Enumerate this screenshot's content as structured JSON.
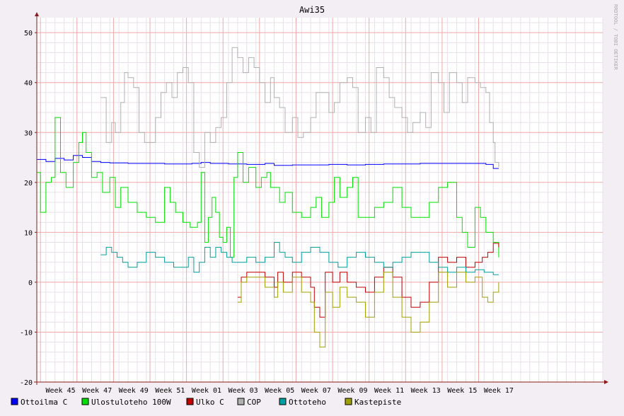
{
  "chart_data": {
    "type": "line",
    "title": "Awi35",
    "watermark": "RRDTOOL / TOBI OETIKER",
    "xlabel": "",
    "ylabel": "",
    "ylim": [
      -20,
      53
    ],
    "yticks": [
      -20,
      -10,
      0,
      10,
      20,
      30,
      40,
      50
    ],
    "xlim": [
      0,
      31
    ],
    "xticks": [
      {
        "x": 1.3,
        "label": "Week 45"
      },
      {
        "x": 3.3,
        "label": "Week 47"
      },
      {
        "x": 5.3,
        "label": "Week 49"
      },
      {
        "x": 7.3,
        "label": "Week 51"
      },
      {
        "x": 9.3,
        "label": "Week 01"
      },
      {
        "x": 11.3,
        "label": "Week 03"
      },
      {
        "x": 13.3,
        "label": "Week 05"
      },
      {
        "x": 15.3,
        "label": "Week 07"
      },
      {
        "x": 17.3,
        "label": "Week 09"
      },
      {
        "x": 19.3,
        "label": "Week 11"
      },
      {
        "x": 21.3,
        "label": "Week 13"
      },
      {
        "x": 23.3,
        "label": "Week 15"
      },
      {
        "x": 25.3,
        "label": "Week 17"
      }
    ],
    "grid": true,
    "legend_position": "bottom",
    "colors": {
      "background": "#f3eef3",
      "canvas": "#ffffff",
      "major_grid": "#f0a8a8",
      "minor_grid": "#e8e0e8",
      "axis": "#8b1a1a"
    },
    "series": [
      {
        "name": "Ottoilma C",
        "color": "#0000ff",
        "points": [
          [
            0,
            24.6
          ],
          [
            0.5,
            24.2
          ],
          [
            1.0,
            24.8
          ],
          [
            1.5,
            24.5
          ],
          [
            2.0,
            25.4
          ],
          [
            2.5,
            25.0
          ],
          [
            3.0,
            24.2
          ],
          [
            3.5,
            24.0
          ],
          [
            4.0,
            23.9
          ],
          [
            5.0,
            23.8
          ],
          [
            6.0,
            23.8
          ],
          [
            7.0,
            23.7
          ],
          [
            7.6,
            23.7
          ],
          [
            8.5,
            23.8
          ],
          [
            9.0,
            24.0
          ],
          [
            9.5,
            23.8
          ],
          [
            10.5,
            23.7
          ],
          [
            11.5,
            23.6
          ],
          [
            12.5,
            23.8
          ],
          [
            13.0,
            23.4
          ],
          [
            14.0,
            23.5
          ],
          [
            15.0,
            23.5
          ],
          [
            16.0,
            23.6
          ],
          [
            17.0,
            23.5
          ],
          [
            18.0,
            23.6
          ],
          [
            19.0,
            23.7
          ],
          [
            20.0,
            23.7
          ],
          [
            21.0,
            23.8
          ],
          [
            22.0,
            23.8
          ],
          [
            23.0,
            23.8
          ],
          [
            24.0,
            23.8
          ],
          [
            24.6,
            23.6
          ],
          [
            25.0,
            22.8
          ],
          [
            25.3,
            22.8
          ]
        ]
      },
      {
        "name": "Ulostuloteho 100W",
        "color": "#00e000",
        "points": [
          [
            0,
            22
          ],
          [
            0.2,
            14
          ],
          [
            0.5,
            20
          ],
          [
            0.8,
            21
          ],
          [
            1.0,
            33
          ],
          [
            1.3,
            22
          ],
          [
            1.6,
            19
          ],
          [
            2.0,
            24
          ],
          [
            2.3,
            28
          ],
          [
            2.5,
            30
          ],
          [
            2.7,
            26
          ],
          [
            3.0,
            21
          ],
          [
            3.3,
            22
          ],
          [
            3.6,
            18
          ],
          [
            4.0,
            21
          ],
          [
            4.3,
            15
          ],
          [
            4.6,
            19
          ],
          [
            5.0,
            16
          ],
          [
            5.5,
            14
          ],
          [
            6.0,
            13
          ],
          [
            6.5,
            12
          ],
          [
            7.0,
            19
          ],
          [
            7.3,
            16
          ],
          [
            7.6,
            14
          ],
          [
            8.0,
            12
          ],
          [
            8.4,
            11
          ],
          [
            8.8,
            12
          ],
          [
            9.0,
            22
          ],
          [
            9.2,
            8
          ],
          [
            9.4,
            13
          ],
          [
            9.6,
            17
          ],
          [
            9.8,
            14
          ],
          [
            10.0,
            9
          ],
          [
            10.2,
            8
          ],
          [
            10.4,
            11
          ],
          [
            10.6,
            5
          ],
          [
            10.8,
            21
          ],
          [
            11.0,
            26
          ],
          [
            11.3,
            20
          ],
          [
            11.6,
            23
          ],
          [
            12.0,
            19
          ],
          [
            12.3,
            21
          ],
          [
            12.6,
            22
          ],
          [
            12.8,
            19
          ],
          [
            13.0,
            19
          ],
          [
            13.3,
            16
          ],
          [
            13.6,
            18
          ],
          [
            14.0,
            14
          ],
          [
            14.5,
            13
          ],
          [
            15.0,
            15
          ],
          [
            15.3,
            17
          ],
          [
            15.6,
            13
          ],
          [
            16.0,
            16
          ],
          [
            16.3,
            21
          ],
          [
            16.6,
            17
          ],
          [
            17.0,
            19
          ],
          [
            17.3,
            21
          ],
          [
            17.6,
            13
          ],
          [
            18.0,
            13
          ],
          [
            18.5,
            15
          ],
          [
            19.0,
            16
          ],
          [
            19.5,
            19
          ],
          [
            20.0,
            15
          ],
          [
            20.5,
            13
          ],
          [
            21.0,
            13
          ],
          [
            21.5,
            16
          ],
          [
            22.0,
            19
          ],
          [
            22.5,
            20
          ],
          [
            23.0,
            13
          ],
          [
            23.3,
            10
          ],
          [
            23.6,
            7
          ],
          [
            24.0,
            15
          ],
          [
            24.3,
            13
          ],
          [
            24.6,
            10
          ],
          [
            25.0,
            8
          ],
          [
            25.3,
            5
          ]
        ]
      },
      {
        "name": "Ulko C",
        "color": "#c00000",
        "points": [
          [
            11.0,
            -3
          ],
          [
            11.2,
            1
          ],
          [
            11.5,
            2
          ],
          [
            12.0,
            2
          ],
          [
            12.5,
            1
          ],
          [
            13.0,
            -1
          ],
          [
            13.2,
            2
          ],
          [
            13.5,
            0
          ],
          [
            14.0,
            2
          ],
          [
            14.5,
            1
          ],
          [
            15.0,
            -1
          ],
          [
            15.2,
            -5
          ],
          [
            15.5,
            -7
          ],
          [
            15.8,
            2
          ],
          [
            16.2,
            0
          ],
          [
            16.6,
            2
          ],
          [
            17.0,
            0
          ],
          [
            17.5,
            -1
          ],
          [
            18.0,
            -2
          ],
          [
            18.5,
            1
          ],
          [
            19.0,
            3
          ],
          [
            19.5,
            1
          ],
          [
            20.0,
            -3
          ],
          [
            20.5,
            -5
          ],
          [
            21.0,
            -4
          ],
          [
            21.5,
            0
          ],
          [
            22.0,
            5
          ],
          [
            22.5,
            4
          ],
          [
            23.0,
            5
          ],
          [
            23.5,
            3
          ],
          [
            24.0,
            4
          ],
          [
            24.4,
            5
          ],
          [
            24.7,
            6
          ],
          [
            25.0,
            7.8
          ],
          [
            25.3,
            7
          ]
        ]
      },
      {
        "name": "COP",
        "color": "#b0b0b0",
        "points": [
          [
            3.5,
            37
          ],
          [
            3.8,
            28
          ],
          [
            4.1,
            32
          ],
          [
            4.3,
            30
          ],
          [
            4.6,
            36
          ],
          [
            4.8,
            42
          ],
          [
            5.0,
            41
          ],
          [
            5.3,
            39
          ],
          [
            5.6,
            30
          ],
          [
            5.9,
            28
          ],
          [
            6.2,
            28
          ],
          [
            6.5,
            33
          ],
          [
            6.8,
            38
          ],
          [
            7.1,
            40
          ],
          [
            7.4,
            37
          ],
          [
            7.7,
            42
          ],
          [
            8.0,
            43
          ],
          [
            8.3,
            40
          ],
          [
            8.6,
            26
          ],
          [
            8.9,
            23
          ],
          [
            9.2,
            30
          ],
          [
            9.5,
            28
          ],
          [
            9.8,
            31
          ],
          [
            10.1,
            33
          ],
          [
            10.4,
            40
          ],
          [
            10.7,
            47
          ],
          [
            11.0,
            45
          ],
          [
            11.3,
            42
          ],
          [
            11.6,
            45
          ],
          [
            11.9,
            43
          ],
          [
            12.2,
            40
          ],
          [
            12.5,
            36
          ],
          [
            12.8,
            41
          ],
          [
            13.0,
            37
          ],
          [
            13.3,
            35
          ],
          [
            13.6,
            30
          ],
          [
            14.0,
            33
          ],
          [
            14.3,
            29
          ],
          [
            14.6,
            30
          ],
          [
            15.0,
            33
          ],
          [
            15.3,
            38
          ],
          [
            15.6,
            38
          ],
          [
            16.0,
            34
          ],
          [
            16.3,
            36
          ],
          [
            16.6,
            40
          ],
          [
            17.0,
            41
          ],
          [
            17.3,
            39
          ],
          [
            17.6,
            30
          ],
          [
            18.0,
            33
          ],
          [
            18.3,
            30
          ],
          [
            18.6,
            43
          ],
          [
            19.0,
            41
          ],
          [
            19.3,
            37
          ],
          [
            19.6,
            35
          ],
          [
            20.0,
            33
          ],
          [
            20.3,
            30
          ],
          [
            20.6,
            32
          ],
          [
            21.0,
            34
          ],
          [
            21.3,
            31
          ],
          [
            21.6,
            42
          ],
          [
            22.0,
            40
          ],
          [
            22.3,
            34
          ],
          [
            22.6,
            42
          ],
          [
            23.0,
            40
          ],
          [
            23.3,
            36
          ],
          [
            23.6,
            41
          ],
          [
            24.0,
            40
          ],
          [
            24.3,
            39
          ],
          [
            24.6,
            38
          ],
          [
            24.8,
            32
          ],
          [
            25.0,
            28
          ],
          [
            25.1,
            24
          ],
          [
            25.3,
            23
          ]
        ]
      },
      {
        "name": "Ottoteho",
        "color": "#00a0a0",
        "points": [
          [
            3.5,
            5.5
          ],
          [
            3.8,
            7
          ],
          [
            4.1,
            6
          ],
          [
            4.4,
            5
          ],
          [
            4.7,
            4
          ],
          [
            5.0,
            3
          ],
          [
            5.5,
            4
          ],
          [
            6.0,
            6
          ],
          [
            6.5,
            5
          ],
          [
            7.0,
            4
          ],
          [
            7.5,
            3
          ],
          [
            8.0,
            3
          ],
          [
            8.3,
            5
          ],
          [
            8.6,
            2
          ],
          [
            8.9,
            4
          ],
          [
            9.2,
            7
          ],
          [
            9.5,
            5
          ],
          [
            9.8,
            7
          ],
          [
            10.1,
            6
          ],
          [
            10.4,
            5
          ],
          [
            10.7,
            4
          ],
          [
            11.0,
            4
          ],
          [
            11.5,
            5
          ],
          [
            12.0,
            4
          ],
          [
            12.5,
            5
          ],
          [
            13.0,
            8
          ],
          [
            13.3,
            6
          ],
          [
            13.6,
            5
          ],
          [
            14.0,
            4
          ],
          [
            14.5,
            6
          ],
          [
            15.0,
            7
          ],
          [
            15.5,
            6
          ],
          [
            16.0,
            4
          ],
          [
            16.5,
            3
          ],
          [
            17.0,
            5
          ],
          [
            17.5,
            6
          ],
          [
            18.0,
            5
          ],
          [
            18.5,
            4
          ],
          [
            19.0,
            3
          ],
          [
            19.5,
            4
          ],
          [
            20.0,
            5
          ],
          [
            20.5,
            6
          ],
          [
            21.0,
            6
          ],
          [
            21.5,
            4
          ],
          [
            22.0,
            3
          ],
          [
            22.5,
            2
          ],
          [
            23.0,
            3
          ],
          [
            23.5,
            2
          ],
          [
            24.0,
            2.5
          ],
          [
            24.5,
            2
          ],
          [
            25.0,
            1.5
          ],
          [
            25.3,
            1.5
          ]
        ]
      },
      {
        "name": "Kastepiste",
        "color": "#a0a000",
        "points": [
          [
            11.0,
            -4
          ],
          [
            11.2,
            0
          ],
          [
            11.5,
            1
          ],
          [
            12.0,
            1
          ],
          [
            12.5,
            -1
          ],
          [
            13.0,
            -3
          ],
          [
            13.2,
            0
          ],
          [
            13.5,
            -2
          ],
          [
            14.0,
            1
          ],
          [
            14.5,
            -2
          ],
          [
            15.0,
            -4
          ],
          [
            15.2,
            -10
          ],
          [
            15.5,
            -13
          ],
          [
            15.8,
            -2
          ],
          [
            16.2,
            -5
          ],
          [
            16.6,
            -1
          ],
          [
            17.0,
            -3
          ],
          [
            17.5,
            -4
          ],
          [
            18.0,
            -7
          ],
          [
            18.5,
            -2
          ],
          [
            19.0,
            2
          ],
          [
            19.5,
            -3
          ],
          [
            20.0,
            -7
          ],
          [
            20.5,
            -10
          ],
          [
            21.0,
            -8
          ],
          [
            21.5,
            -4
          ],
          [
            22.0,
            2
          ],
          [
            22.5,
            -1
          ],
          [
            23.0,
            2
          ],
          [
            23.5,
            0
          ],
          [
            24.0,
            1
          ],
          [
            24.4,
            -3
          ],
          [
            24.7,
            -4
          ],
          [
            25.0,
            -2
          ],
          [
            25.3,
            0
          ]
        ]
      }
    ]
  }
}
